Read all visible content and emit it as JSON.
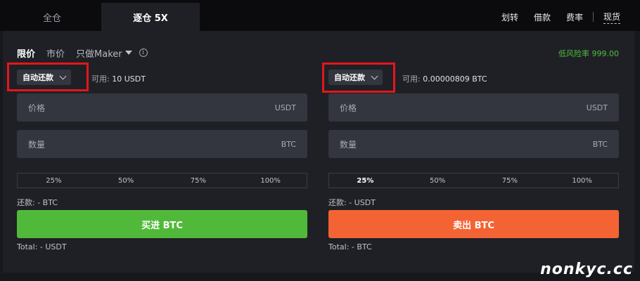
{
  "topbar": {
    "tabs": [
      {
        "label": "全仓"
      },
      {
        "label": "逐仓 5X"
      }
    ],
    "links": [
      "划转",
      "借款",
      "费率"
    ],
    "spot": "现货"
  },
  "order_types": {
    "limit": "限价",
    "market": "市价",
    "maker": "只做Maker",
    "info_icon": "i"
  },
  "risk_label": "低风险率 999.00",
  "buy_side": {
    "repay_mode": "自动还款",
    "available_label": "可用:",
    "available_value": "10 USDT",
    "price_placeholder": "价格",
    "price_unit": "USDT",
    "qty_placeholder": "数量",
    "qty_unit": "BTC",
    "percents": [
      "25%",
      "50%",
      "75%",
      "100%"
    ],
    "repay_line": "还款: - BTC",
    "action": "买进 BTC",
    "total": "Total: - USDT"
  },
  "sell_side": {
    "repay_mode": "自动还款",
    "available_label": "可用:",
    "available_value": "0.00000809 BTC",
    "price_placeholder": "价格",
    "price_unit": "USDT",
    "qty_placeholder": "数量",
    "qty_unit": "BTC",
    "percents": [
      "25%",
      "50%",
      "75%",
      "100%"
    ],
    "repay_line": "还款: - USDT",
    "action": "卖出 BTC",
    "total": "Total: - BTC"
  },
  "watermark": "nonkyc.cc",
  "colors": {
    "buy": "#51b93a",
    "sell": "#f46334",
    "risk": "#4fbf3a",
    "highlight": "#e3161b"
  }
}
